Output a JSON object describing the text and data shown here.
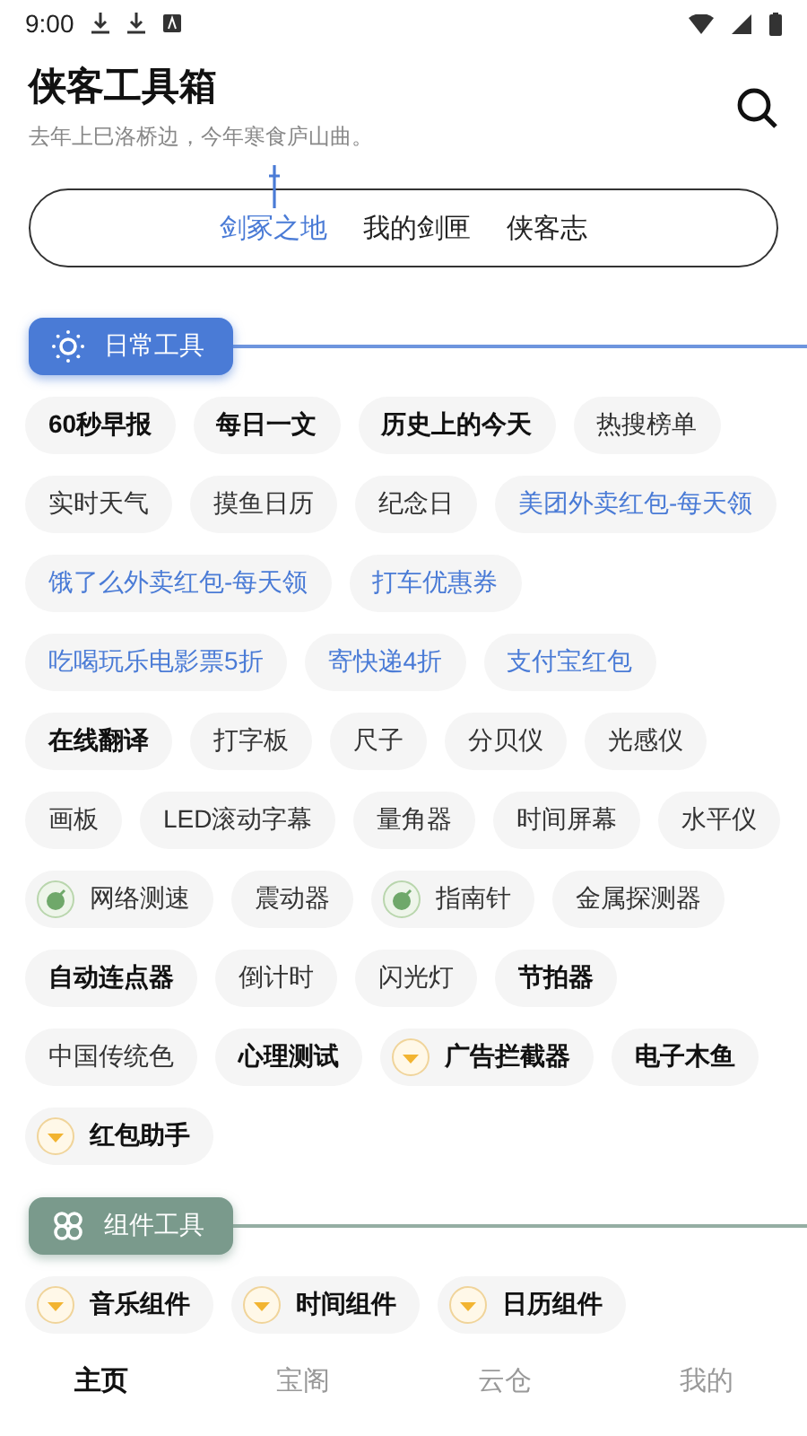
{
  "status_bar": {
    "time": "9:00"
  },
  "header": {
    "title": "侠客工具箱",
    "subtitle": "去年上巳洛桥边，今年寒食庐山曲。"
  },
  "tabs": [
    {
      "label": "剑冢之地",
      "selected": true
    },
    {
      "label": "我的剑匣",
      "selected": false
    },
    {
      "label": "侠客志",
      "selected": false
    }
  ],
  "sections": [
    {
      "title": "日常工具",
      "kind": "daily",
      "chips": [
        {
          "label": "60秒早报",
          "kind": "bold"
        },
        {
          "label": "每日一文",
          "kind": "bold"
        },
        {
          "label": "历史上的今天",
          "kind": "bold"
        },
        {
          "label": "热搜榜单",
          "kind": "plain"
        },
        {
          "label": "实时天气",
          "kind": "plain"
        },
        {
          "label": "摸鱼日历",
          "kind": "plain"
        },
        {
          "label": "纪念日",
          "kind": "plain"
        },
        {
          "label": "美团外卖红包-每天领",
          "kind": "promo"
        },
        {
          "label": "饿了么外卖红包-每天领",
          "kind": "promo"
        },
        {
          "label": "打车优惠券",
          "kind": "promo"
        },
        {
          "label": "吃喝玩乐电影票5折",
          "kind": "promo"
        },
        {
          "label": "寄快递4折",
          "kind": "promo"
        },
        {
          "label": "支付宝红包",
          "kind": "promo"
        },
        {
          "label": "在线翻译",
          "kind": "bold"
        },
        {
          "label": "打字板",
          "kind": "plain"
        },
        {
          "label": "尺子",
          "kind": "plain"
        },
        {
          "label": "分贝仪",
          "kind": "plain"
        },
        {
          "label": "光感仪",
          "kind": "plain"
        },
        {
          "label": "画板",
          "kind": "plain"
        },
        {
          "label": "LED滚动字幕",
          "kind": "plain"
        },
        {
          "label": "量角器",
          "kind": "plain"
        },
        {
          "label": "时间屏幕",
          "kind": "plain"
        },
        {
          "label": "水平仪",
          "kind": "plain"
        },
        {
          "label": "网络测速",
          "kind": "green"
        },
        {
          "label": "震动器",
          "kind": "plain"
        },
        {
          "label": "指南针",
          "kind": "green"
        },
        {
          "label": "金属探测器",
          "kind": "plain"
        },
        {
          "label": "自动连点器",
          "kind": "bold"
        },
        {
          "label": "倒计时",
          "kind": "plain"
        },
        {
          "label": "闪光灯",
          "kind": "plain"
        },
        {
          "label": "节拍器",
          "kind": "bold"
        },
        {
          "label": "中国传统色",
          "kind": "plain"
        },
        {
          "label": "心理测试",
          "kind": "bold"
        },
        {
          "label": "广告拦截器",
          "kind": "vip"
        },
        {
          "label": "电子木鱼",
          "kind": "bold"
        },
        {
          "label": "红包助手",
          "kind": "vip"
        }
      ]
    },
    {
      "title": "组件工具",
      "kind": "widget",
      "chips": [
        {
          "label": "音乐组件",
          "kind": "vip"
        },
        {
          "label": "时间组件",
          "kind": "vip"
        },
        {
          "label": "日历组件",
          "kind": "vip"
        }
      ]
    }
  ],
  "bottom_nav": [
    {
      "label": "主页",
      "selected": true
    },
    {
      "label": "宝阁",
      "selected": false
    },
    {
      "label": "云仓",
      "selected": false
    },
    {
      "label": "我的",
      "selected": false
    }
  ]
}
